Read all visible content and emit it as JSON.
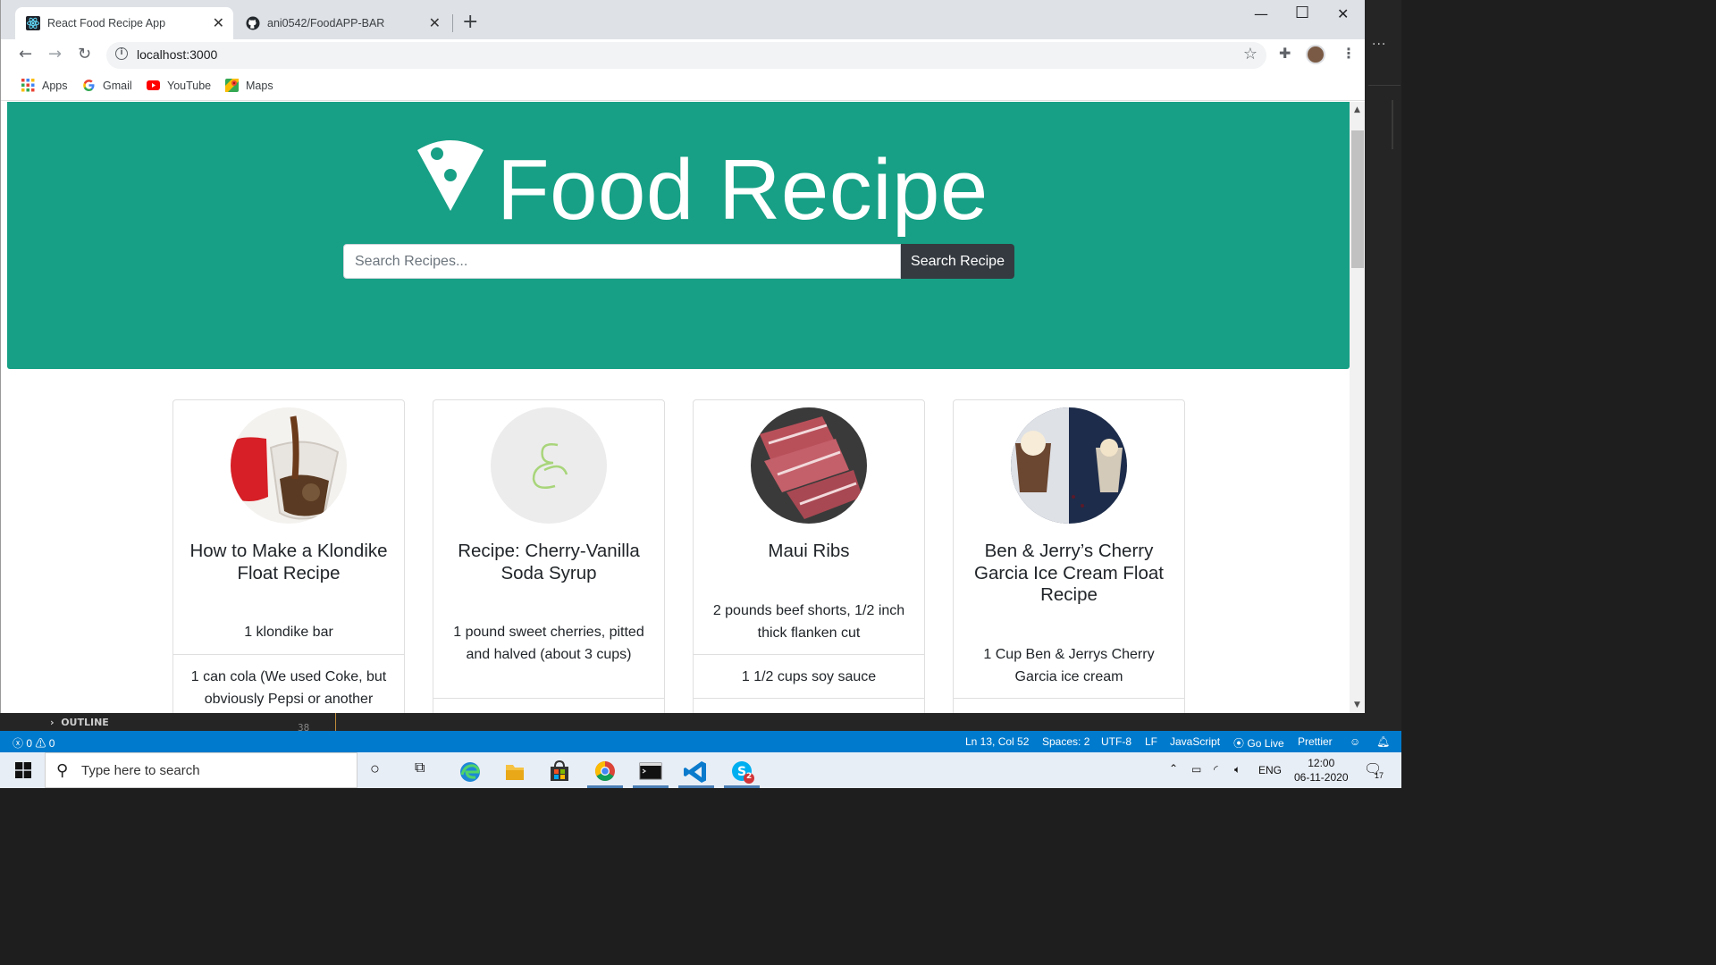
{
  "browser": {
    "tabs": [
      {
        "title": "React Food Recipe App",
        "active": true
      },
      {
        "title": "ani0542/FoodAPP-BAR",
        "active": false
      }
    ],
    "new_tab": "+",
    "url": "localhost:3000",
    "bookmarks": [
      "Apps",
      "Gmail",
      "YouTube",
      "Maps"
    ]
  },
  "page": {
    "brand": "Food Recipe",
    "search": {
      "placeholder": "Search Recipes...",
      "button": "Search Recipe"
    },
    "recipes": [
      {
        "title": "How to Make a Klondike Float Recipe",
        "ingredients": [
          "1 klondike bar",
          "1 can cola (We used Coke, but obviously Pepsi or another"
        ]
      },
      {
        "title": "Recipe: Cherry-Vanilla Soda Syrup",
        "ingredients": [
          "1 pound sweet cherries, pitted and halved (about 3 cups)"
        ]
      },
      {
        "title": "Maui Ribs",
        "ingredients": [
          "2 pounds beef shorts, 1/2 inch thick flanken cut",
          "1 1/2 cups soy sauce"
        ]
      },
      {
        "title": "Ben & Jerry’s Cherry Garcia Ice Cream Float Recipe",
        "ingredients": [
          "1 Cup Ben & Jerrys Cherry Garcia ice cream"
        ]
      }
    ]
  },
  "editor": {
    "outline_label": "OUTLINE",
    "line_number": "38",
    "more": "..."
  },
  "statusbar": {
    "errors": "0",
    "warnings": "0",
    "position": "Ln 13, Col 52",
    "spaces": "Spaces: 2",
    "encoding": "UTF-8",
    "eol": "LF",
    "language": "JavaScript",
    "golive": "Go Live",
    "formatter": "Prettier"
  },
  "taskbar": {
    "search_placeholder": "Type here to search",
    "language": "ENG",
    "time": "12:00",
    "date": "06-11-2020",
    "notifications": "17",
    "skype_badge": "2"
  },
  "colors": {
    "hero": "#17a085",
    "search_button": "#343a40",
    "statusbar": "#007acc"
  }
}
